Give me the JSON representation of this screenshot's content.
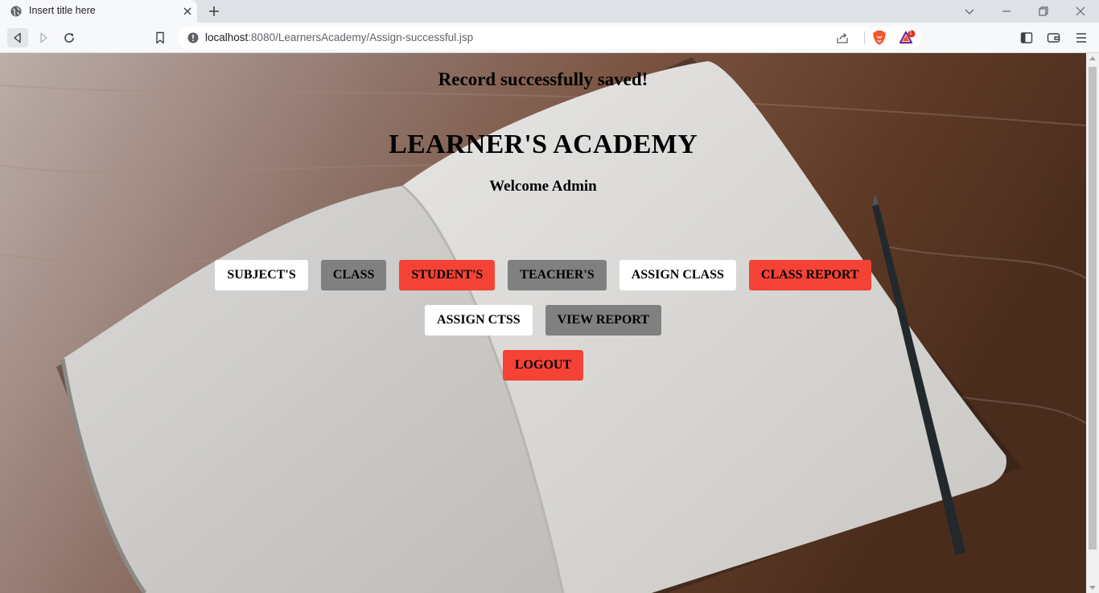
{
  "browser": {
    "tab_title": "Insert title here",
    "url_host": "localhost",
    "url_rest": ":8080/LearnersAcademy/Assign-successful.jsp",
    "rewards_badge": "1",
    "accent_brave": "#fb542b"
  },
  "page": {
    "status_message": "Record successfully saved!",
    "title": "LEARNER'S ACADEMY",
    "welcome": "Welcome Admin"
  },
  "nav": {
    "row1": [
      {
        "label": "SUBJECT'S",
        "color": "#ffffff"
      },
      {
        "label": "CLASS",
        "color": "#808080"
      },
      {
        "label": "STUDENT'S",
        "color": "#f44336"
      },
      {
        "label": "TEACHER'S",
        "color": "#808080"
      },
      {
        "label": "ASSIGN CLASS",
        "color": "#ffffff"
      },
      {
        "label": "CLASS REPORT",
        "color": "#f44336"
      }
    ],
    "row2": [
      {
        "label": "ASSIGN CTSS",
        "color": "#ffffff"
      },
      {
        "label": "VIEW REPORT",
        "color": "#808080"
      }
    ],
    "row3": [
      {
        "label": "LOGOUT",
        "color": "#f44336"
      }
    ]
  },
  "icons": {
    "tab_favicon": "globe-icon",
    "tab_close": "close-icon",
    "new_tab": "plus-icon",
    "back": "back-arrow-icon",
    "forward": "forward-arrow-icon",
    "reload": "reload-icon",
    "bookmark": "bookmark-icon",
    "site_info": "info-icon",
    "share": "share-icon",
    "brave_shields": "brave-lion-icon",
    "brave_rewards": "triangle-rewards-icon",
    "sidebar": "sidebar-icon",
    "wallet": "wallet-icon",
    "menu": "hamburger-menu-icon"
  }
}
